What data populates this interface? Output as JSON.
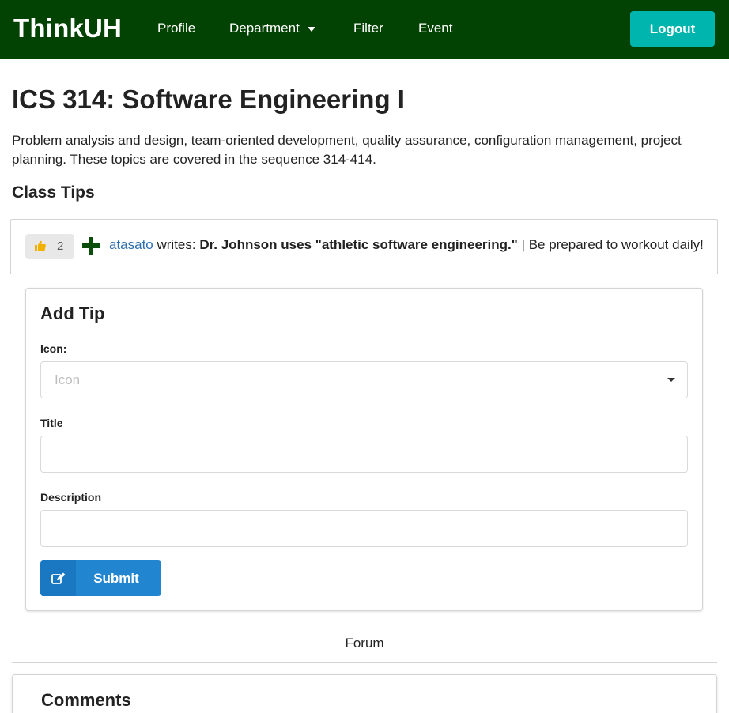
{
  "navbar": {
    "brand": "ThinkUH",
    "items": [
      {
        "label": "Profile"
      },
      {
        "label": "Department"
      },
      {
        "label": "Filter"
      },
      {
        "label": "Event"
      }
    ],
    "logout_label": "Logout",
    "colors": {
      "background": "#024202",
      "logout": "#00b5ad"
    }
  },
  "course": {
    "title": "ICS 314: Software Engineering I",
    "description": "Problem analysis and design, team-oriented development, quality assurance, configuration management, project planning. These topics are covered in the sequence 314-414."
  },
  "class_tips": {
    "heading": "Class Tips",
    "tips": [
      {
        "likes": "2",
        "like_icon": "thumbs-up-icon",
        "add_icon": "plus-icon",
        "author": "atasato",
        "verb": " writes: ",
        "title": "Dr. Johnson uses \"athletic software engineering.\"",
        "description": " | Be prepared to workout daily!"
      }
    ]
  },
  "add_tip": {
    "heading": "Add Tip",
    "icon_label": "Icon:",
    "icon_placeholder": "Icon",
    "title_label": "Title",
    "title_value": "",
    "description_label": "Description",
    "description_value": "",
    "submit_label": "Submit",
    "submit_icon": "edit-icon",
    "colors": {
      "submit": "#2185d0"
    }
  },
  "forum": {
    "label": "Forum",
    "comments_heading": "Comments"
  }
}
